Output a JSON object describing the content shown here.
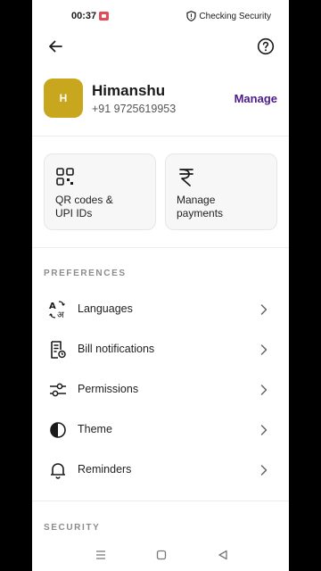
{
  "status_bar": {
    "time": "00:37",
    "security_text": "Checking Security"
  },
  "profile": {
    "avatar_initial": "H",
    "name": "Himanshu",
    "phone": "+91 9725619953",
    "manage_label": "Manage"
  },
  "cards": [
    {
      "label_line1": "QR codes &",
      "label_line2": "UPI IDs",
      "icon": "qr-code-icon"
    },
    {
      "label_line1": "Manage",
      "label_line2": "payments",
      "icon": "rupee-icon"
    }
  ],
  "preferences": {
    "title": "PREFERENCES",
    "items": [
      {
        "label": "Languages",
        "icon": "language-icon"
      },
      {
        "label": "Bill notifications",
        "icon": "bill-icon"
      },
      {
        "label": "Permissions",
        "icon": "sliders-icon"
      },
      {
        "label": "Theme",
        "icon": "theme-icon"
      },
      {
        "label": "Reminders",
        "icon": "bell-icon"
      }
    ]
  },
  "security": {
    "title": "SECURITY"
  },
  "colors": {
    "accent": "#4b1a8c",
    "avatar_bg": "#c8a61e"
  }
}
